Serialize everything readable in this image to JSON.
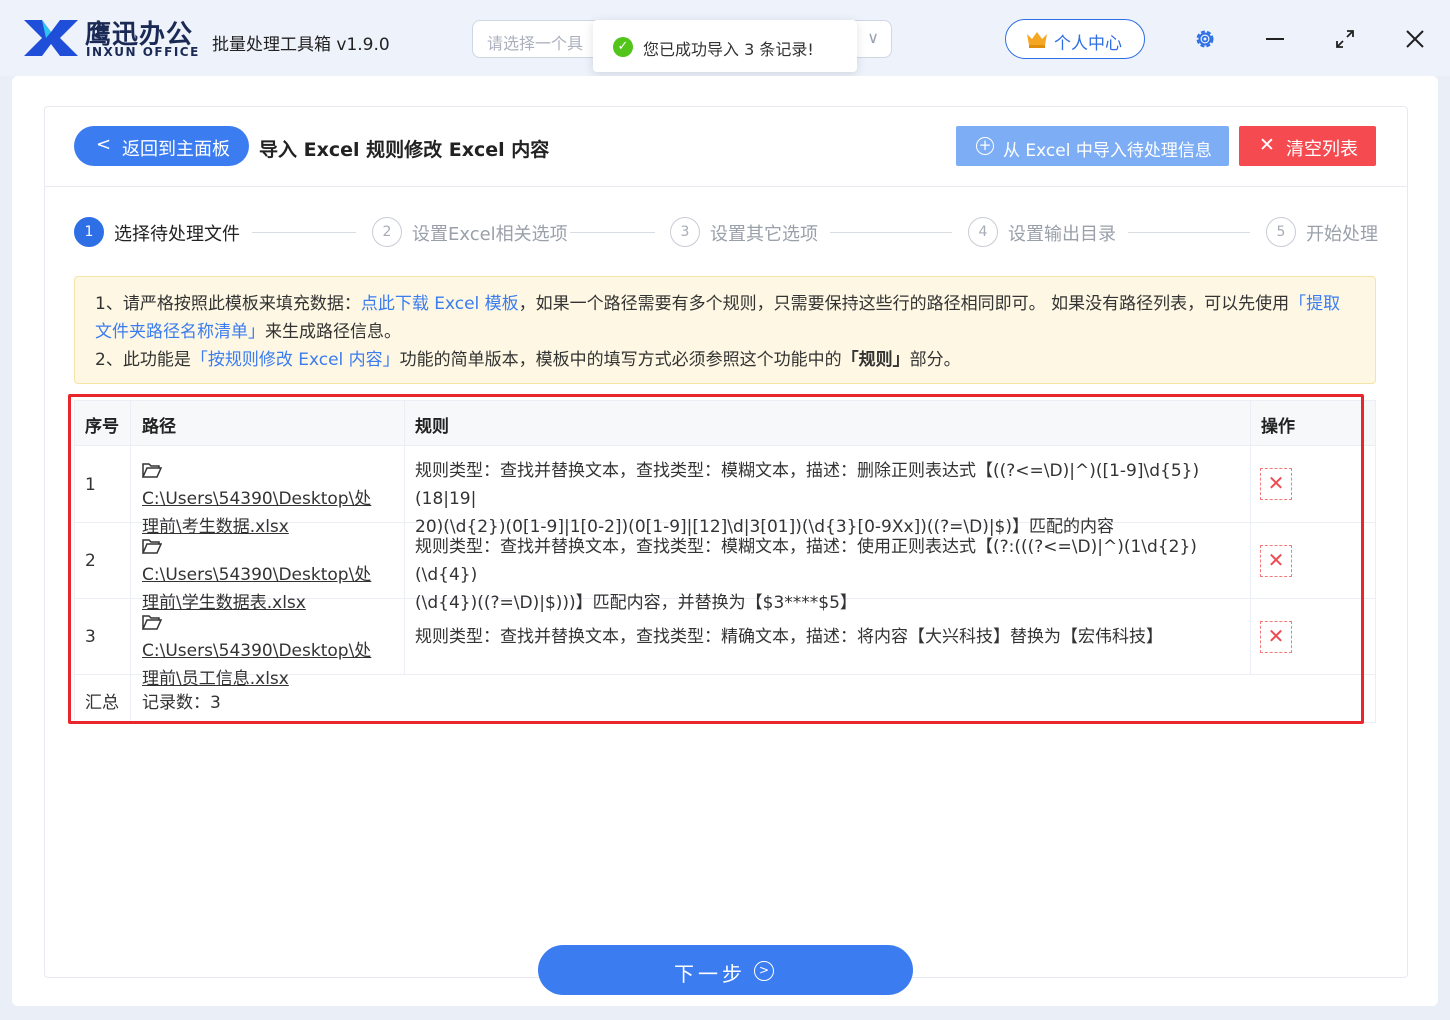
{
  "header": {
    "brand_cn": "鹰迅办公",
    "brand_en": "INXUN OFFICE",
    "app_title": "批量处理工具箱 v1.9.0",
    "select_placeholder": "请选择一个具",
    "user_center": "个人中心"
  },
  "toast": {
    "message": "您已成功导入 3 条记录!"
  },
  "toolbar": {
    "back_label": "返回到主面板",
    "page_title": "导入 Excel 规则修改 Excel 内容",
    "import_label": "从 Excel 中导入待处理信息",
    "clear_label": "清空列表"
  },
  "steps": [
    {
      "num": "1",
      "label": "选择待处理文件"
    },
    {
      "num": "2",
      "label": "设置Excel相关选项"
    },
    {
      "num": "3",
      "label": "设置其它选项"
    },
    {
      "num": "4",
      "label": "设置输出目录"
    },
    {
      "num": "5",
      "label": "开始处理"
    }
  ],
  "notice": {
    "l1_a": "1、请严格按照此模板来填充数据：",
    "l1_link": "点此下载 Excel 模板",
    "l1_b": "，如果一个路径需要有多个规则，只需要保持这些行的路径相同即可。 如果没有路径列表，可以先使用",
    "l1_link2": "「提取文件夹路径名称清单」",
    "l1_c": "来生成路径信息。",
    "l2_a": "2、此功能是",
    "l2_link": "「按规则修改 Excel 内容」",
    "l2_b": "功能的简单版本，模板中的填写方式必须参照这个功能中的",
    "l2_bold": "「规则」",
    "l2_c": "部分。"
  },
  "table": {
    "headers": {
      "index": "序号",
      "path": "路径",
      "rule": "规则",
      "action": "操作"
    },
    "rows": [
      {
        "index": "1",
        "path_a": "C:\\Users\\54390\\Desktop\\处",
        "path_b": "理前\\考生数据.xlsx",
        "rule_a": "规则类型：查找并替换文本，查找类型：模糊文本，描述：删除正则表达式【((?<=\\D)|^)([1-9]\\d{5})(18|19|",
        "rule_b": "20)(\\d{2})(0[1-9]|1[0-2])(0[1-9]|[12]\\d|3[01])(\\d{3}[0-9Xx])((?=\\D)|$)】匹配的内容"
      },
      {
        "index": "2",
        "path_a": "C:\\Users\\54390\\Desktop\\处",
        "path_b": "理前\\学生数据表.xlsx",
        "rule_a": "规则类型：查找并替换文本，查找类型：模糊文本，描述：使用正则表达式【(?:(((?<=\\D)|^)(1\\d{2})(\\d{4})",
        "rule_b": "(\\d{4})((?=\\D)|$)))】匹配内容，并替换为【$3****$5】"
      },
      {
        "index": "3",
        "path_a": "C:\\Users\\54390\\Desktop\\处",
        "path_b": "理前\\员工信息.xlsx",
        "rule_a": "规则类型：查找并替换文本，查找类型：精确文本，描述：将内容【大兴科技】替换为【宏伟科技】",
        "rule_b": ""
      }
    ],
    "summary_label": "汇总",
    "summary_value": "记录数：3"
  },
  "footer": {
    "next_label": "下一步"
  },
  "colors": {
    "accent": "#3b7cf0",
    "danger": "#f54a4f",
    "highlight_frame": "#e8262b",
    "success": "#52c41a"
  }
}
